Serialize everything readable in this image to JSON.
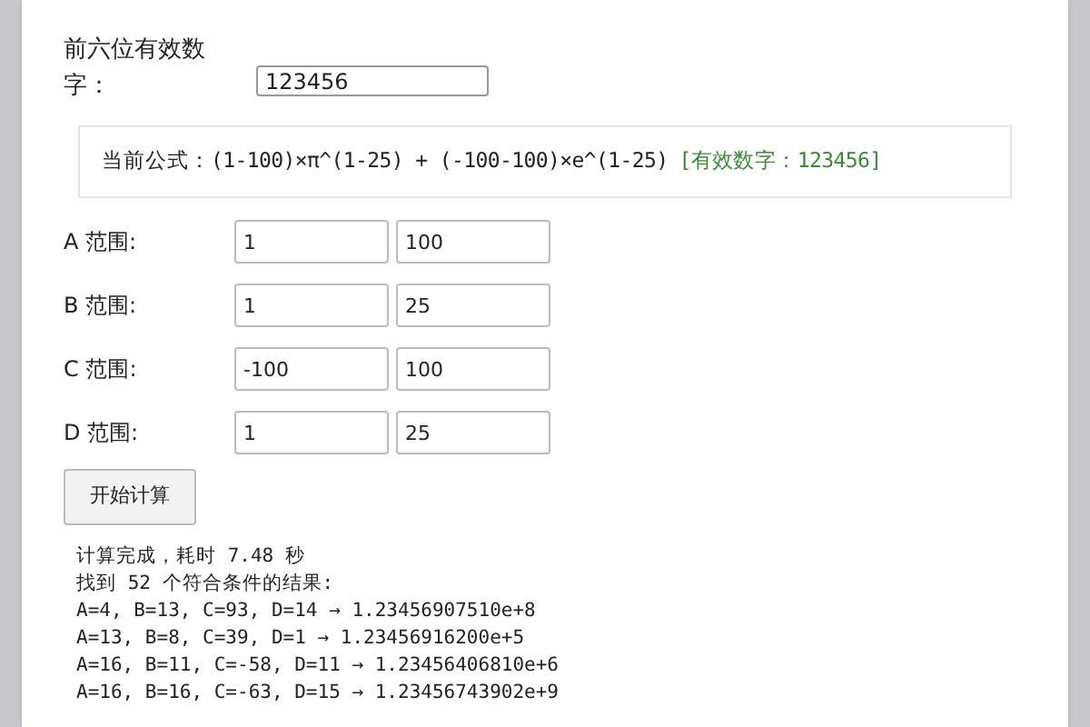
{
  "precision": {
    "label": "前六位有效数字：",
    "value": "123456"
  },
  "formula": {
    "label": "当前公式：",
    "expression": "(1-100)×π^(1-25) + (-100-100)×e^(1-25)",
    "digits": "[有效数字：123456]"
  },
  "ranges": [
    {
      "label": "A 范围:",
      "min": "1",
      "max": "100"
    },
    {
      "label": "B 范围:",
      "min": "1",
      "max": "25"
    },
    {
      "label": "C 范围:",
      "min": "-100",
      "max": "100"
    },
    {
      "label": "D 范围:",
      "min": "1",
      "max": "25"
    }
  ],
  "button": "开始计算",
  "output": [
    "计算完成，耗时 7.48 秒",
    "找到 52 个符合条件的结果:",
    "A=4, B=13, C=93, D=14 → 1.23456907510e+8",
    "A=13, B=8, C=39, D=1 → 1.23456916200e+5",
    "A=16, B=11, C=-58, D=11 → 1.23456406810e+6",
    "A=16, B=16, C=-63, D=15 → 1.23456743902e+9"
  ]
}
